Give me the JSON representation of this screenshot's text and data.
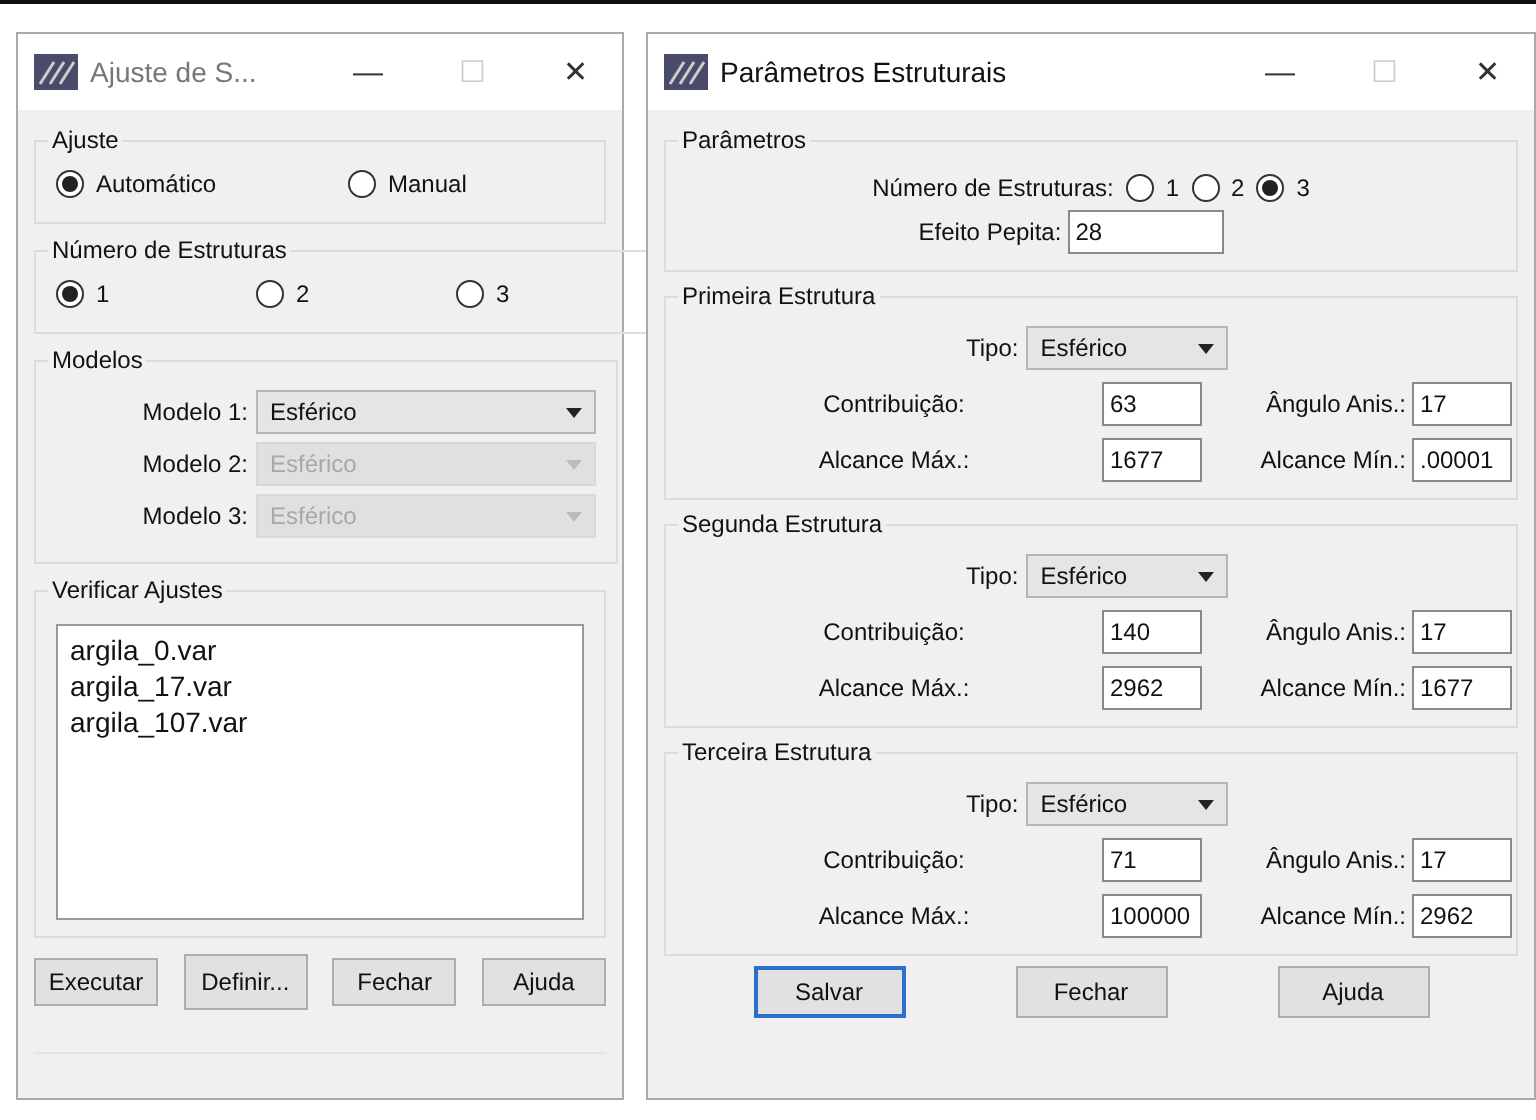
{
  "fit_window": {
    "title": "Ajuste de S...",
    "controls": [
      "—",
      "☐",
      "✕"
    ],
    "adjust": {
      "title": "Ajuste",
      "options": [
        {
          "label": "Automático",
          "selected": true
        },
        {
          "label": "Manual",
          "selected": false
        }
      ]
    },
    "structures": {
      "title": "Número de Estruturas",
      "options": [
        {
          "label": "1",
          "selected": true
        },
        {
          "label": "2",
          "selected": false
        },
        {
          "label": "3",
          "selected": false
        }
      ]
    },
    "models": {
      "title": "Modelos",
      "items": [
        {
          "label": "Modelo 1:",
          "value": "Esférico",
          "disabled": false
        },
        {
          "label": "Modelo 2:",
          "value": "Esférico",
          "disabled": true
        },
        {
          "label": "Modelo 3:",
          "value": "Esférico",
          "disabled": true
        }
      ]
    },
    "verify": {
      "title": "Verificar Ajustes",
      "files": [
        "argila_0.var",
        "argila_17.var",
        "argila_107.var"
      ]
    },
    "buttons": [
      "Executar",
      "Definir...",
      "Fechar",
      "Ajuda"
    ]
  },
  "params_window": {
    "title": "Parâmetros Estruturais",
    "controls": [
      "—",
      "☐",
      "✕"
    ],
    "params": {
      "title": "Parâmetros",
      "count_label": "Número de Estruturas:",
      "options": [
        {
          "label": "1",
          "selected": false
        },
        {
          "label": "2",
          "selected": false
        },
        {
          "label": "3",
          "selected": true
        }
      ],
      "nugget_label": "Efeito Pepita:",
      "nugget": "28"
    },
    "structures": [
      {
        "title": "Primeira Estrutura",
        "type_label": "Tipo:",
        "type": "Esférico",
        "contribution_label": "Contribuição:",
        "contribution": "63",
        "angle_label": "Ângulo Anis.:",
        "angle": "17",
        "max_label": "Alcance Máx.:",
        "max": "1677",
        "min_label": "Alcance Mín.:",
        "min": ".00001"
      },
      {
        "title": "Segunda Estrutura",
        "type_label": "Tipo:",
        "type": "Esférico",
        "contribution_label": "Contribuição:",
        "contribution": "140",
        "angle_label": "Ângulo Anis.:",
        "angle": "17",
        "max_label": "Alcance Máx.:",
        "max": "2962",
        "min_label": "Alcance Mín.:",
        "min": "1677"
      },
      {
        "title": "Terceira Estrutura",
        "type_label": "Tipo:",
        "type": "Esférico",
        "contribution_label": "Contribuição:",
        "contribution": "71",
        "angle_label": "Ângulo Anis.:",
        "angle": "17",
        "max_label": "Alcance Máx.:",
        "max": "100000",
        "min_label": "Alcance Mín.:",
        "min": "2962"
      }
    ],
    "buttons": [
      {
        "label": "Salvar",
        "focused": true
      },
      {
        "label": "Fechar",
        "focused": false
      },
      {
        "label": "Ajuda",
        "focused": false
      }
    ]
  }
}
